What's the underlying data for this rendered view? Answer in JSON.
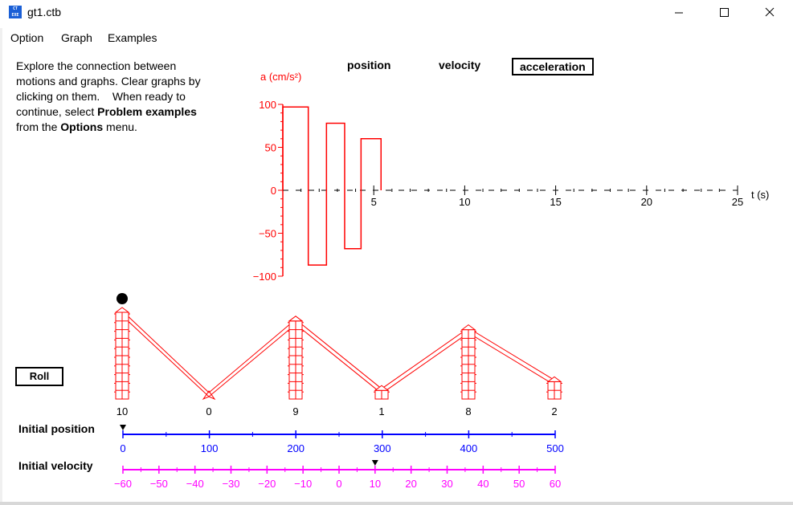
{
  "window": {
    "title": "gt1.ctb",
    "icon_name": "app-window-icon"
  },
  "menubar": {
    "items": [
      "Option",
      "Graph",
      "Examples"
    ]
  },
  "intro": {
    "line1": "Explore the connection between",
    "line2": "motions and graphs.  Clear graphs by",
    "line3": "clicking on them.    When ready to",
    "line4_pre": "continue, select ",
    "line4_bold": "Problem examples",
    "line5_pre": "from the ",
    "line5_bold": "Options",
    "line5_post": " menu."
  },
  "graph_tabs": {
    "position": "position",
    "velocity": "velocity",
    "acceleration": "acceleration",
    "selected": "acceleration"
  },
  "chart_data": {
    "type": "line",
    "ylabel": "a (cm/s²)",
    "xlabel": "t (s)",
    "color": "#ff0000",
    "xlim": [
      0,
      25
    ],
    "ylim": [
      -100,
      100
    ],
    "x_ticks": [
      5,
      10,
      15,
      20,
      25
    ],
    "y_ticks": [
      100,
      50,
      0,
      -50,
      -100
    ],
    "series": [
      {
        "x": [
          0,
          0,
          1.4,
          1.4,
          2.4,
          2.4,
          3.4,
          3.4,
          4.3,
          4.3,
          5.4,
          5.4
        ],
        "y": [
          0,
          97,
          97,
          -87,
          -87,
          78,
          78,
          -68,
          -68,
          60,
          60,
          0
        ]
      }
    ]
  },
  "track": {
    "post_heights": [
      "10",
      "0",
      "9",
      "1",
      "8",
      "2"
    ]
  },
  "roll_button": {
    "label": "Roll"
  },
  "initial_position": {
    "label": "Initial position",
    "ticks": [
      "0",
      "100",
      "200",
      "300",
      "400",
      "500"
    ],
    "value": 0,
    "color": "#0000ff"
  },
  "initial_velocity": {
    "label": "Initial velocity",
    "ticks": [
      "-60",
      "-50",
      "-40",
      "-30",
      "-20",
      "-10",
      "0",
      "10",
      "20",
      "30",
      "40",
      "50",
      "60"
    ],
    "value": 10,
    "color": "#ff00ff"
  }
}
